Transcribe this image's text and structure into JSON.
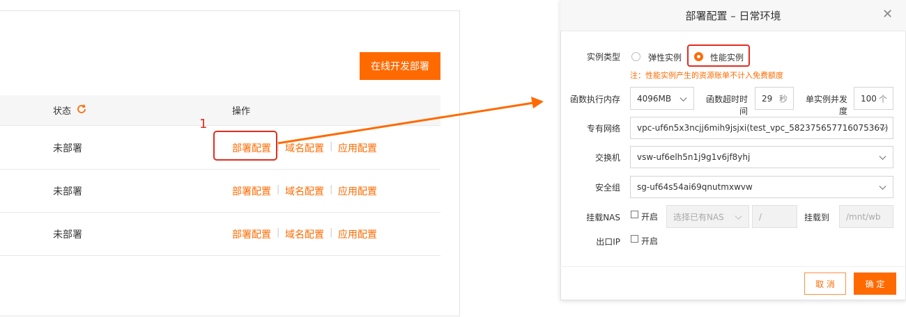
{
  "left": {
    "deploy_button": "在线开发部署",
    "columns": {
      "status": "状态",
      "actions": "操作"
    },
    "rows": [
      {
        "status": "未部署",
        "a1": "部署配置",
        "a2": "域名配置",
        "a3": "应用配置"
      },
      {
        "status": "未部署",
        "a1": "部署配置",
        "a2": "域名配置",
        "a3": "应用配置"
      },
      {
        "status": "未部署",
        "a1": "部署配置",
        "a2": "域名配置",
        "a3": "应用配置"
      }
    ],
    "separator": "|",
    "step_number": "1"
  },
  "dialog": {
    "title": "部署配置 – 日常环境",
    "instance_type": {
      "label": "实例类型",
      "options": [
        "弹性实例",
        "性能实例"
      ],
      "selected": "性能实例",
      "note": "注：性能实例产生的资源账单不计入免费额度"
    },
    "memory": {
      "label": "函数执行内存",
      "value": "4096MB"
    },
    "timeout": {
      "label": "函数超时时间",
      "value": "29",
      "unit": "秒"
    },
    "concurrency": {
      "label": "单实例并发度",
      "value": "100",
      "unit": "个"
    },
    "vpc": {
      "label": "专有网络",
      "value": "vpc-uf6n5x3ncjj6mih9jsjxi(test_vpc_582375657716075367)"
    },
    "vswitch": {
      "label": "交换机",
      "value": "vsw-uf6elh5n1j9g1v6jf8yhj"
    },
    "security_group": {
      "label": "安全组",
      "value": "sg-uf64s54ai69qnutmxwvw"
    },
    "nas": {
      "label": "挂载NAS",
      "enable": "开启",
      "select_placeholder": "选择已有NAS",
      "path": "/",
      "mount_label": "挂载到",
      "mount_path": "/mnt/wb"
    },
    "egress_ip": {
      "label": "出口IP",
      "enable": "开启"
    },
    "cancel": "取 消",
    "ok": "确 定"
  },
  "colors": {
    "accent": "#ff6a00",
    "callout": "#e32b1f",
    "arrow": "#ff6a00"
  }
}
